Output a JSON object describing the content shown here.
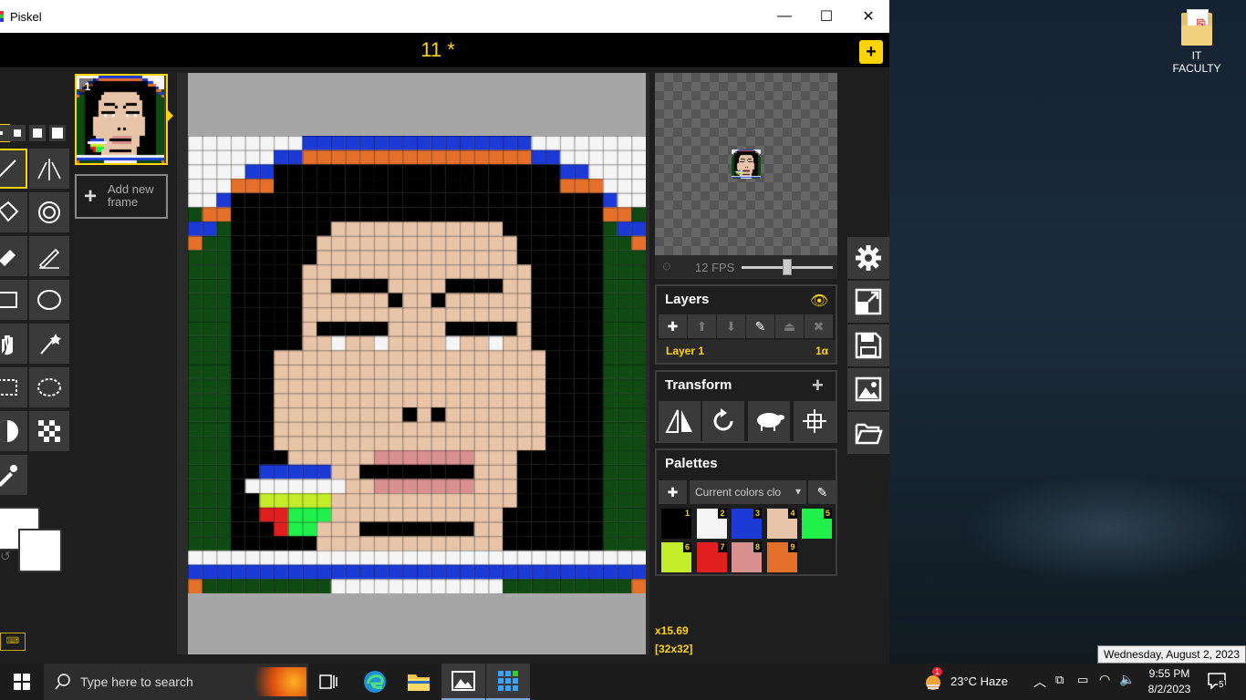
{
  "window": {
    "title": "Piskel",
    "minimize": "—",
    "maximize": "☐",
    "close": "✕"
  },
  "app": {
    "project_title": "11 *",
    "new_button": "+"
  },
  "frames": [
    {
      "number": "1"
    }
  ],
  "add_frame": {
    "plus": "+",
    "label": "Add new frame"
  },
  "preview": {
    "fps_label": "12 FPS",
    "fps_value": 12
  },
  "layers": {
    "title": "Layers",
    "items": [
      {
        "name": "Layer 1",
        "opacity": "1α"
      }
    ]
  },
  "transform": {
    "title": "Transform",
    "add": "+"
  },
  "palettes": {
    "title": "Palettes",
    "selected": "Current colors clo",
    "colors": [
      {
        "n": "1",
        "hex": "#000000"
      },
      {
        "n": "2",
        "hex": "#f5f5f5"
      },
      {
        "n": "3",
        "hex": "#1c3ad6"
      },
      {
        "n": "4",
        "hex": "#e8c4a8"
      },
      {
        "n": "5",
        "hex": "#1ff04a"
      },
      {
        "n": "6",
        "hex": "#c3ec29"
      },
      {
        "n": "7",
        "hex": "#e21f1f"
      },
      {
        "n": "8",
        "hex": "#d9918f"
      },
      {
        "n": "9",
        "hex": "#e5702a"
      }
    ]
  },
  "status": {
    "zoom": "x15.69",
    "size": "[32x32]"
  },
  "desktop": {
    "icon_label": "IT FACULTY"
  },
  "taskbar": {
    "search_placeholder": "Type here to search",
    "weather": "23°C  Haze",
    "weather_badge": "1",
    "time": "9:55 PM",
    "date": "8/2/2023",
    "notif_count": "5",
    "tooltip": "Wednesday, August 2, 2023"
  }
}
